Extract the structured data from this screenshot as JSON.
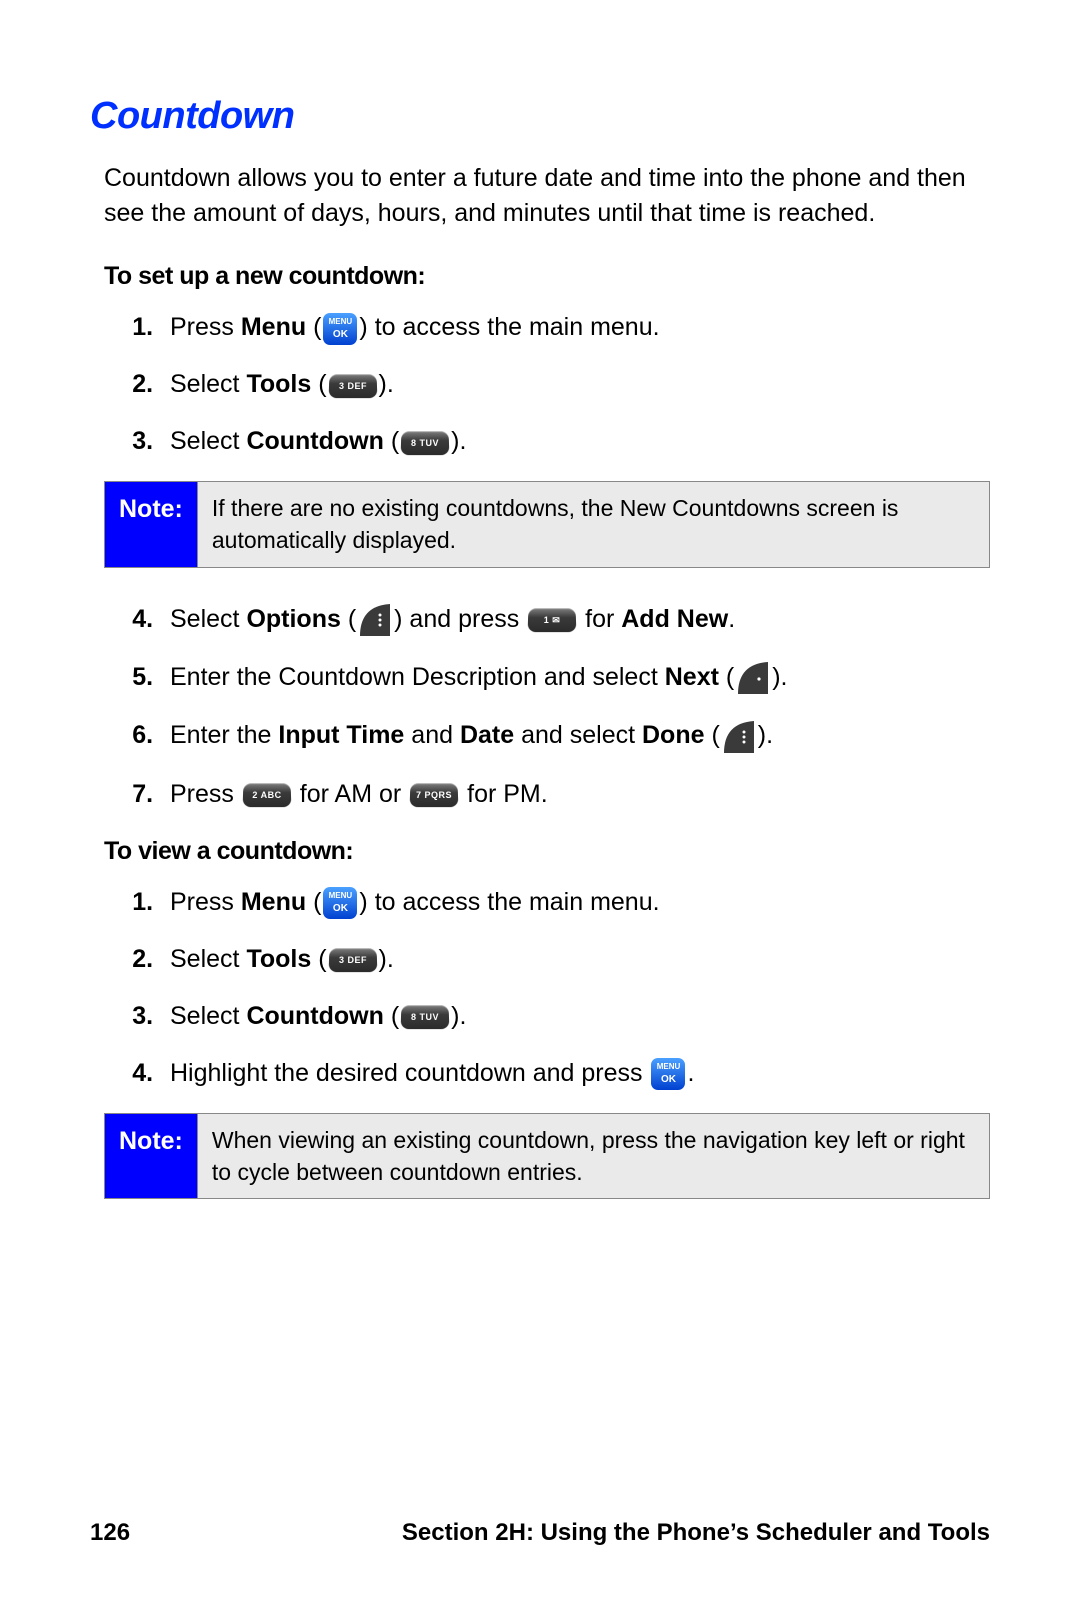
{
  "title": "Countdown",
  "intro": "Countdown allows you to enter a future date and time into the phone and then see the amount of days, hours, and minutes until that time is reached.",
  "setup": {
    "heading": "To set up a new countdown:",
    "steps": {
      "s1a": "Press ",
      "s1b": "Menu",
      "s1c": " (",
      "s1d": ") to access the main menu.",
      "s2a": "Select ",
      "s2b": "Tools",
      "s2c": " (",
      "s2d": ").",
      "s3a": "Select ",
      "s3b": "Countdown",
      "s3c": " (",
      "s3d": ").",
      "s4a": "Select ",
      "s4b": "Options",
      "s4c": " (",
      "s4d": ") and press ",
      "s4e": " for ",
      "s4f": "Add New",
      "s4g": ".",
      "s5a": "Enter the Countdown Description and select ",
      "s5b": "Next",
      "s5c": " (",
      "s5d": ").",
      "s6a": "Enter the ",
      "s6b": "Input Time",
      "s6c": " and ",
      "s6d": "Date",
      "s6e": " and select ",
      "s6f": "Done",
      "s6g": " (",
      "s6h": ").",
      "s7a": "Press ",
      "s7b": " for AM or ",
      "s7c": " for PM."
    }
  },
  "note1": {
    "label": "Note:",
    "text": "If there are no existing countdowns, the New Countdowns screen is automatically displayed."
  },
  "view": {
    "heading": "To view a countdown:",
    "steps": {
      "v1a": "Press ",
      "v1b": "Menu",
      "v1c": " (",
      "v1d": ") to access the main menu.",
      "v2a": "Select ",
      "v2b": "Tools",
      "v2c": " (",
      "v2d": ").",
      "v3a": "Select ",
      "v3b": "Countdown",
      "v3c": " (",
      "v3d": ").",
      "v4a": "Highlight the desired countdown and press ",
      "v4b": "."
    }
  },
  "note2": {
    "label": "Note:",
    "text": "When viewing an existing countdown, press the navigation key left or right to cycle between countdown entries."
  },
  "footer": {
    "page": "126",
    "section": "Section 2H: Using the Phone’s Scheduler and Tools"
  }
}
